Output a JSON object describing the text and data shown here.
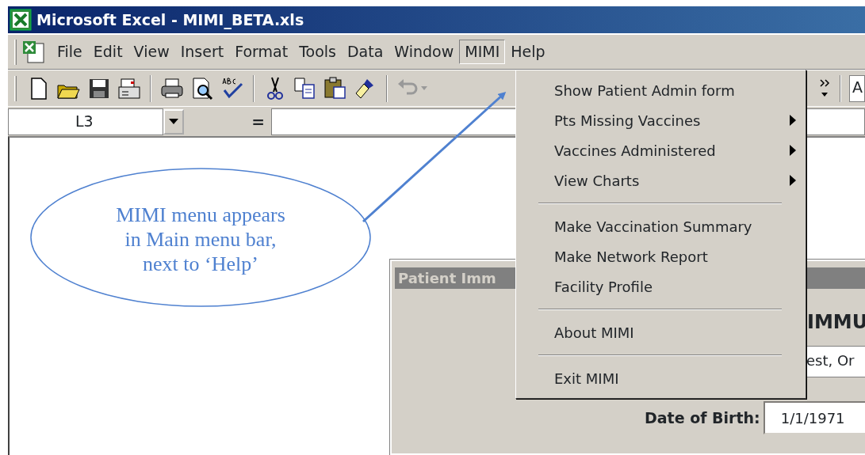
{
  "window": {
    "title": "Microsoft Excel - MIMI_BETA.xls"
  },
  "menu_bar": [
    {
      "label": "File",
      "selected": false
    },
    {
      "label": "Edit",
      "selected": false
    },
    {
      "label": "View",
      "selected": false
    },
    {
      "label": "Insert",
      "selected": false
    },
    {
      "label": "Format",
      "selected": false
    },
    {
      "label": "Tools",
      "selected": false
    },
    {
      "label": "Data",
      "selected": false
    },
    {
      "label": "Window",
      "selected": false
    },
    {
      "label": "MIMI",
      "selected": true
    },
    {
      "label": "Help",
      "selected": false
    }
  ],
  "toolbar": {
    "font_box": "A"
  },
  "formula_bar": {
    "name_box": "L3",
    "equals": "="
  },
  "dropdown_menu": [
    {
      "kind": "item",
      "label": "Show Patient Admin form",
      "submenu": false
    },
    {
      "kind": "item",
      "label": "Pts Missing Vaccines",
      "submenu": true
    },
    {
      "kind": "item",
      "label": "Vaccines Administered",
      "submenu": true
    },
    {
      "kind": "item",
      "label": "View Charts",
      "submenu": true
    },
    {
      "kind": "separator"
    },
    {
      "kind": "item",
      "label": "Make Vaccination Summary",
      "submenu": false
    },
    {
      "kind": "item",
      "label": "Make Network Report",
      "submenu": false
    },
    {
      "kind": "item",
      "label": "Facility Profile",
      "submenu": false
    },
    {
      "kind": "separator"
    },
    {
      "kind": "item",
      "label": "About MIMI",
      "submenu": false
    },
    {
      "kind": "separator"
    },
    {
      "kind": "item",
      "label": "Exit MIMI",
      "submenu": false
    }
  ],
  "dialog": {
    "title": "Patient Imm",
    "heading": "IMMU",
    "name_value": "est, Or",
    "dob_label": "Date of Birth:",
    "dob_value": "1/1/1971"
  },
  "callout": {
    "lines": [
      "MIMI menu appears",
      "in Main menu bar,",
      "next to ‘Help’"
    ]
  }
}
